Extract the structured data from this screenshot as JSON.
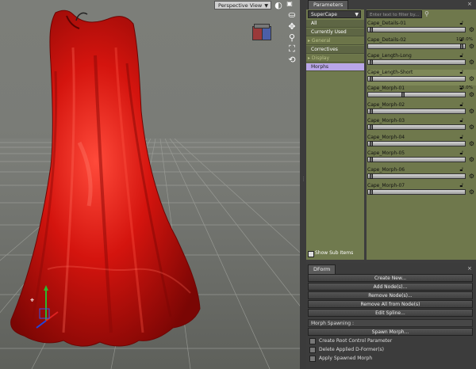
{
  "viewport": {
    "view_label": "Perspective View",
    "icons": [
      "pose-tool-icon",
      "move-tool-icon",
      "zoom-tool-icon",
      "frame-icon",
      "orbit-icon"
    ]
  },
  "parameters": {
    "tab_label": "Parameters",
    "node_select": "SuperCape",
    "filter_placeholder": "Enter text to filter by...",
    "categories": [
      {
        "label": "All"
      },
      {
        "label": "Currently Used"
      },
      {
        "label": "General"
      },
      {
        "label": "Correctives"
      },
      {
        "label": "Display"
      },
      {
        "label": "Morphs"
      }
    ],
    "show_sub_items": "Show Sub Items",
    "rows": [
      {
        "name": "Cape_Details-01",
        "value": "",
        "level": 0.0
      },
      {
        "name": "Cape_Details-02",
        "value": "100.0%",
        "level": 1.0
      },
      {
        "name": "Cape_Length-Long",
        "value": "",
        "level": 0.0
      },
      {
        "name": "Cape_Length-Short",
        "value": "",
        "level": 0.0
      },
      {
        "name": "Cape_Morph-01",
        "value": "35.0%",
        "level": 0.35
      },
      {
        "name": "Cape_Morph-02",
        "value": "",
        "level": 0.0
      },
      {
        "name": "Cape_Morph-03",
        "value": "",
        "level": 0.0
      },
      {
        "name": "Cape_Morph-04",
        "value": "",
        "level": 0.0
      },
      {
        "name": "Cape_Morph-05",
        "value": "",
        "level": 0.0
      },
      {
        "name": "Cape_Morph-06",
        "value": "",
        "level": 0.0
      },
      {
        "name": "Cape_Morph-07",
        "value": "",
        "level": 0.0
      }
    ]
  },
  "dform": {
    "tab_label": "DForm",
    "buttons": [
      "Create New...",
      "Add Node(s)...",
      "Remove Node(s)...",
      "Remove All from Node(s)",
      "Edit Spline..."
    ],
    "morph_spawning": "Morph Spawning :",
    "spawn_button": "Spawn Morph...",
    "options": [
      "Create Root Control Parameter",
      "Delete Applied D-Former(s)",
      "Apply Spawned Morph"
    ]
  },
  "colors": {
    "dress": "#c8120e",
    "panel_green": "#707a4e",
    "selected_category": "#b9a6e8"
  }
}
